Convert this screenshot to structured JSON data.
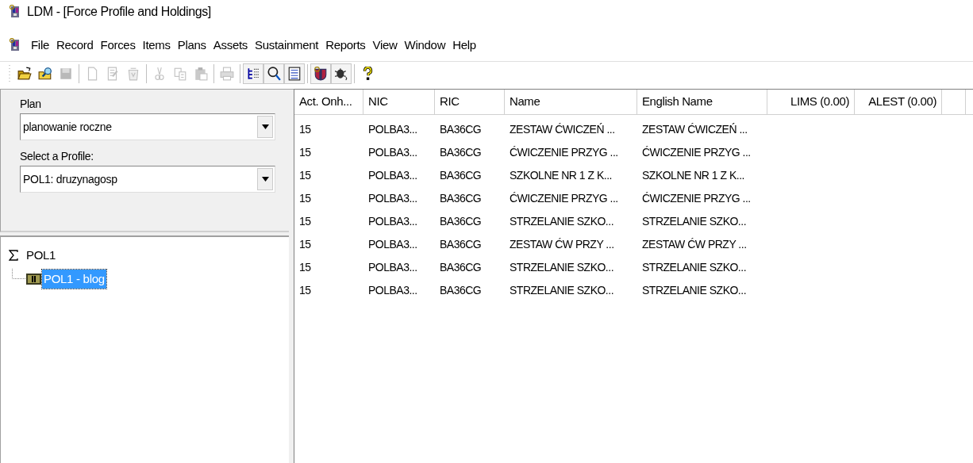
{
  "window": {
    "title": "LDM - [Force Profile and Holdings]"
  },
  "menu": [
    "File",
    "Record",
    "Forces",
    "Items",
    "Plans",
    "Assets",
    "Sustainment",
    "Reports",
    "View",
    "Window",
    "Help"
  ],
  "toolbar": [
    [
      {
        "kind": "open",
        "disabled": false,
        "pressed": false
      },
      {
        "kind": "find",
        "disabled": false,
        "pressed": false
      },
      {
        "kind": "save",
        "disabled": true,
        "pressed": false
      }
    ],
    [
      {
        "kind": "new",
        "disabled": true,
        "pressed": false
      },
      {
        "kind": "edit",
        "disabled": true,
        "pressed": false
      },
      {
        "kind": "recycle",
        "disabled": true,
        "pressed": false
      }
    ],
    [
      {
        "kind": "cut",
        "disabled": true,
        "pressed": false
      },
      {
        "kind": "copy",
        "disabled": true,
        "pressed": false
      },
      {
        "kind": "paste",
        "disabled": true,
        "pressed": false
      }
    ],
    [
      {
        "kind": "print",
        "disabled": true,
        "pressed": false
      }
    ],
    [
      {
        "kind": "tree",
        "disabled": false,
        "pressed": true
      },
      {
        "kind": "search",
        "disabled": false,
        "pressed": true
      },
      {
        "kind": "list",
        "disabled": false,
        "pressed": true
      }
    ],
    [
      {
        "kind": "app",
        "disabled": false,
        "pressed": true
      },
      {
        "kind": "bug",
        "disabled": false,
        "pressed": true
      }
    ],
    [
      {
        "kind": "help",
        "disabled": false,
        "pressed": false
      }
    ]
  ],
  "form": {
    "plan_label": "Plan",
    "plan_value": "planowanie roczne",
    "profile_label": "Select a Profile:",
    "profile_value": "POL1: druzynagosp"
  },
  "tree": [
    {
      "label": "POL1",
      "kind": "sum",
      "selected": false,
      "expanded": true,
      "children": [
        {
          "label": "POL1 - blog",
          "kind": "unit",
          "selected": true
        }
      ]
    }
  ],
  "table": {
    "columns": [
      "Act. Onh...",
      "NIC",
      "RIC",
      "Name",
      "English Name",
      "LIMS (0.00)",
      "ALEST (0.00)"
    ],
    "rows": [
      [
        "15",
        "POLBA3...",
        "BA36CG",
        "ZESTAW ĆWICZEŃ ...",
        "ZESTAW ĆWICZEŃ ..."
      ],
      [
        "15",
        "POLBA3...",
        "BA36CG",
        "ĆWICZENIE PRZYG ...",
        "ĆWICZENIE PRZYG ..."
      ],
      [
        "15",
        "POLBA3...",
        "BA36CG",
        "SZKOLNE NR 1 Z K...",
        "SZKOLNE NR 1 Z K..."
      ],
      [
        "15",
        "POLBA3...",
        "BA36CG",
        "ĆWICZENIE PRZYG ...",
        "ĆWICZENIE PRZYG ..."
      ],
      [
        "15",
        "POLBA3...",
        "BA36CG",
        "STRZELANIE SZKO...",
        "STRZELANIE SZKO..."
      ],
      [
        "15",
        "POLBA3...",
        "BA36CG",
        "ZESTAW ĆW PRZY ...",
        "ZESTAW ĆW PRZY ..."
      ],
      [
        "15",
        "POLBA3...",
        "BA36CG",
        "STRZELANIE SZKO...",
        "STRZELANIE SZKO..."
      ],
      [
        "15",
        "POLBA3...",
        "BA36CG",
        "STRZELANIE SZKO...",
        "STRZELANIE SZKO..."
      ]
    ]
  }
}
